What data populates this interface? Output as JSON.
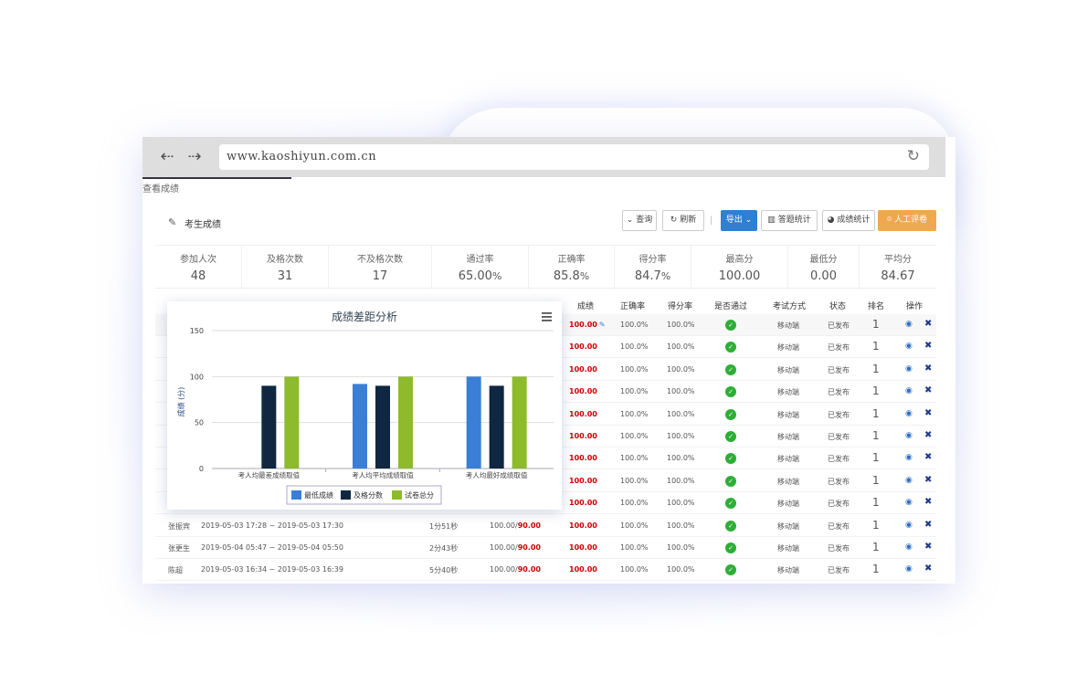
{
  "browser": {
    "url": "www.kaoshiyun.com.cn"
  },
  "breadcrumb": "查看成绩",
  "panel": {
    "title": "考生成绩",
    "buttons": {
      "query": "查询",
      "refresh": "刷新",
      "export": "导出",
      "question_stats": "答题统计",
      "score_stats": "成绩统计",
      "manual_grade": "人工评卷"
    }
  },
  "stats": [
    {
      "label": "参加人次",
      "value": "48"
    },
    {
      "label": "及格次数",
      "value": "31"
    },
    {
      "label": "不及格次数",
      "value": "17"
    },
    {
      "label": "通过率",
      "value": "65.00",
      "unit": "%"
    },
    {
      "label": "正确率",
      "value": "85.8",
      "unit": "%"
    },
    {
      "label": "得分率",
      "value": "84.7",
      "unit": "%"
    },
    {
      "label": "最高分",
      "value": "100.00"
    },
    {
      "label": "最低分",
      "value": "0.00"
    },
    {
      "label": "平均分",
      "value": "84.67"
    }
  ],
  "table": {
    "headers": {
      "score": "成绩",
      "correct_rate": "正确率",
      "score_rate": "得分率",
      "passed": "是否通过",
      "mode": "考试方式",
      "status": "状态",
      "rank": "排名",
      "actions": "操作"
    },
    "rows": [
      {
        "name": "",
        "time_range": "",
        "duration": "",
        "score_pair": "",
        "score_pair_total": "",
        "score": "100.00",
        "correct_rate": "100.0%",
        "score_rate": "100.0%",
        "mode": "移动端",
        "status": "已发布",
        "rank": "1"
      },
      {
        "name": "",
        "time_range": "",
        "duration": "",
        "score_pair": "",
        "score_pair_total": "",
        "score": "100.00",
        "correct_rate": "100.0%",
        "score_rate": "100.0%",
        "mode": "移动端",
        "status": "已发布",
        "rank": "1"
      },
      {
        "name": "",
        "time_range": "",
        "duration": "",
        "score_pair": "",
        "score_pair_total": "",
        "score": "100.00",
        "correct_rate": "100.0%",
        "score_rate": "100.0%",
        "mode": "移动端",
        "status": "已发布",
        "rank": "1"
      },
      {
        "name": "",
        "time_range": "",
        "duration": "",
        "score_pair": "",
        "score_pair_total": "",
        "score": "100.00",
        "correct_rate": "100.0%",
        "score_rate": "100.0%",
        "mode": "移动端",
        "status": "已发布",
        "rank": "1"
      },
      {
        "name": "",
        "time_range": "",
        "duration": "",
        "score_pair": "",
        "score_pair_total": "",
        "score": "100.00",
        "correct_rate": "100.0%",
        "score_rate": "100.0%",
        "mode": "移动端",
        "status": "已发布",
        "rank": "1"
      },
      {
        "name": "",
        "time_range": "",
        "duration": "",
        "score_pair": "",
        "score_pair_total": "",
        "score": "100.00",
        "correct_rate": "100.0%",
        "score_rate": "100.0%",
        "mode": "移动端",
        "status": "已发布",
        "rank": "1"
      },
      {
        "name": "",
        "time_range": "",
        "duration": "",
        "score_pair": "",
        "score_pair_total": "",
        "score": "100.00",
        "correct_rate": "100.0%",
        "score_rate": "100.0%",
        "mode": "移动端",
        "status": "已发布",
        "rank": "1"
      },
      {
        "name": "",
        "time_range": "",
        "duration": "",
        "score_pair": "",
        "score_pair_total": "",
        "score": "100.00",
        "correct_rate": "100.0%",
        "score_rate": "100.0%",
        "mode": "移动端",
        "status": "已发布",
        "rank": "1"
      },
      {
        "name": "",
        "time_range": "",
        "duration": "",
        "score_pair": "",
        "score_pair_total": "",
        "score": "100.00",
        "correct_rate": "100.0%",
        "score_rate": "100.0%",
        "mode": "移动端",
        "status": "已发布",
        "rank": "1"
      },
      {
        "name": "张振宾",
        "time_range": "2019-05-03 17:28 ~ 2019-05-03 17:30",
        "duration": "1分51秒",
        "score_pair": "100.00/",
        "score_pair_total": "90.00",
        "score": "100.00",
        "correct_rate": "100.0%",
        "score_rate": "100.0%",
        "mode": "移动端",
        "status": "已发布",
        "rank": "1"
      },
      {
        "name": "张更生",
        "time_range": "2019-05-04 05:47 ~ 2019-05-04 05:50",
        "duration": "2分43秒",
        "score_pair": "100.00/",
        "score_pair_total": "90.00",
        "score": "100.00",
        "correct_rate": "100.0%",
        "score_rate": "100.0%",
        "mode": "移动端",
        "status": "已发布",
        "rank": "1"
      },
      {
        "name": "陈超",
        "time_range": "2019-05-03 16:34 ~ 2019-05-03 16:39",
        "duration": "5分40秒",
        "score_pair": "100.00/",
        "score_pair_total": "90.00",
        "score": "100.00",
        "correct_rate": "100.0%",
        "score_rate": "100.0%",
        "mode": "移动端",
        "status": "已发布",
        "rank": "1"
      }
    ]
  },
  "colors": {
    "primary": "#2f7fd3",
    "orange": "#f0a850",
    "pass_green": "#2eae36",
    "score_red": "#cc0000"
  },
  "icons": {
    "back": "arrow-left-icon",
    "forward": "arrow-right-icon",
    "reload": "reload-icon",
    "menu": "hamburger-menu-icon",
    "check": "check-circle-icon",
    "view": "eye-icon",
    "delete": "close-icon"
  },
  "chart_data": {
    "type": "bar",
    "title": "成绩差距分析",
    "ylabel": "成绩 (分)",
    "ylim": [
      0,
      150
    ],
    "yticks": [
      "0",
      "50",
      "100",
      "150"
    ],
    "categories": [
      "考人均最差成绩取值",
      "考人均平均成绩取值",
      "考人均最好成绩取值"
    ],
    "series": [
      {
        "name": "最低成绩",
        "color": "#3a7fd5",
        "values": [
          0,
          92,
          100
        ]
      },
      {
        "name": "及格分数",
        "color": "#0f2740",
        "values": [
          90,
          90,
          90
        ]
      },
      {
        "name": "试卷总分",
        "color": "#8dbb2c",
        "values": [
          100,
          100,
          100
        ]
      }
    ],
    "legend": "bottom-center"
  }
}
